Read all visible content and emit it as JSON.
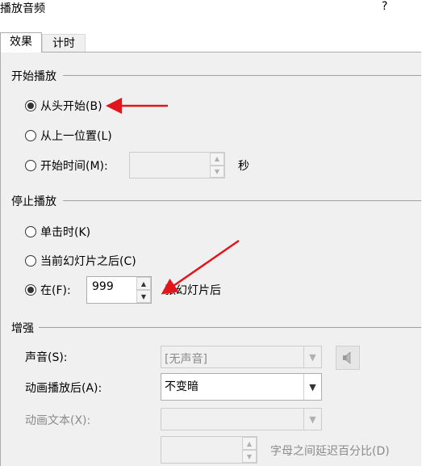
{
  "window": {
    "title": "播放音频",
    "help": "?"
  },
  "tabs": [
    {
      "label": "效果",
      "active": true
    },
    {
      "label": "计时",
      "active": false
    }
  ],
  "start": {
    "group_title": "开始播放",
    "options": [
      {
        "label": "从头开始(B)",
        "checked": true
      },
      {
        "label": "从上一位置(L)",
        "checked": false
      },
      {
        "label": "开始时间(M):",
        "checked": false
      }
    ],
    "time_value": "",
    "time_unit": "秒"
  },
  "stop": {
    "group_title": "停止播放",
    "options": [
      {
        "label": "单击时(K)",
        "checked": false
      },
      {
        "label": "当前幻灯片之后(C)",
        "checked": false
      },
      {
        "label": "在(F):",
        "checked": true
      }
    ],
    "slides_value": "999",
    "slides_suffix": "张幻灯片后"
  },
  "enhance": {
    "group_title": "增强",
    "sound_label": "声音(S):",
    "sound_value": "[无声音]",
    "after_anim_label": "动画播放后(A):",
    "after_anim_value": "不变暗",
    "anim_text_label": "动画文本(X):",
    "anim_text_value": "",
    "delay_value": "",
    "delay_label": "字母之间延迟百分比(D)"
  },
  "colors": {
    "annotation_arrow": "#e0161c"
  }
}
